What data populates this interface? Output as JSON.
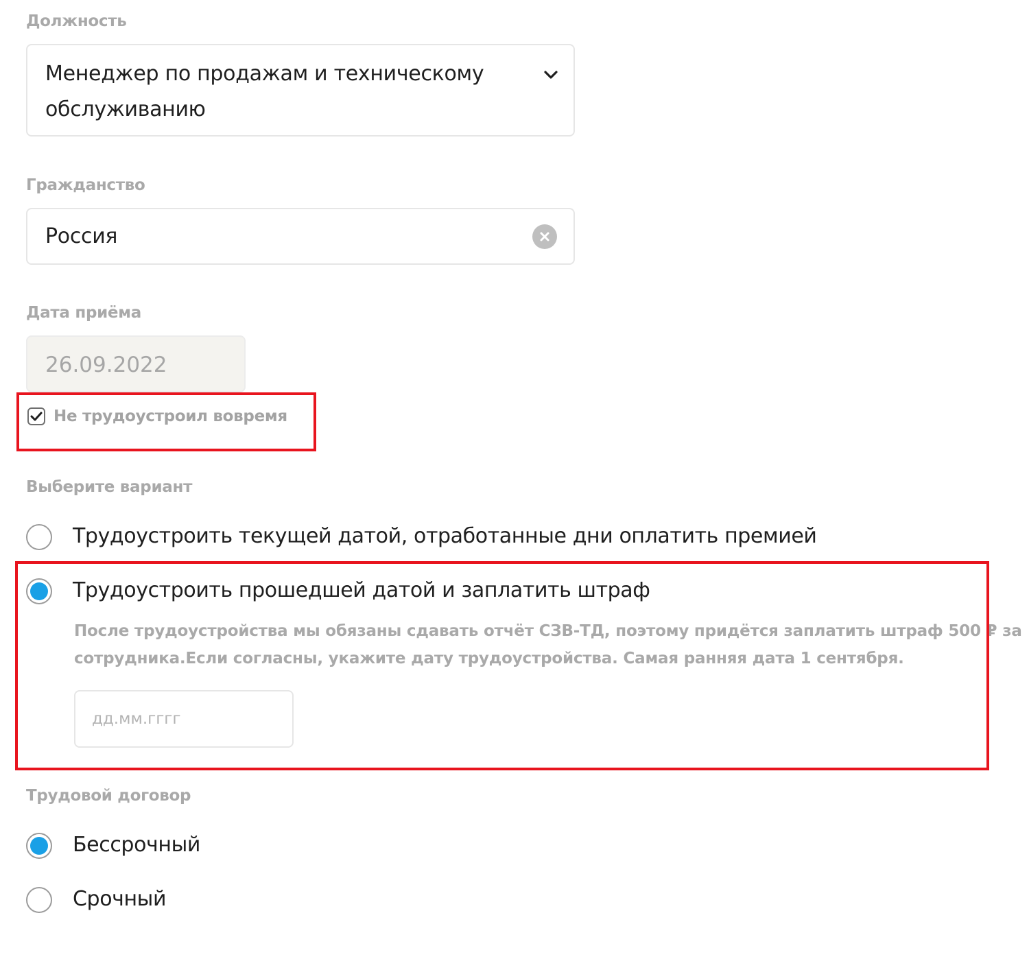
{
  "position": {
    "label": "Должность",
    "value_line1": "Менеджер по продажам и техническому",
    "value_line2": "обслуживанию",
    "icon": "chevron-down-icon"
  },
  "citizenship": {
    "label": "Гражданство",
    "value": "Россия",
    "icon": "clear-icon"
  },
  "hire_date": {
    "label": "Дата приёма",
    "value": "26.09.2022",
    "checkbox_label": "Не трудоустроил вовремя",
    "checkbox_checked": true
  },
  "variant": {
    "label": "Выберите вариант",
    "options": [
      {
        "label": "Трудоустроить текущей датой, отработанные дни оплатить премией",
        "selected": false
      },
      {
        "label": "Трудоустроить прошедшей датой и заплатить штраф",
        "selected": true
      }
    ],
    "hint_line1": "После трудоустройства мы обязаны сдавать отчёт СЗВ-ТД, поэтому придётся заплатить штраф 500 ₽ за",
    "hint_line2": "сотрудника.Если согласны, укажите дату трудоустройства. Самая ранняя дата 1 сентября.",
    "date_placeholder": "дд.мм.гггг"
  },
  "contract": {
    "label": "Трудовой договор",
    "options": [
      {
        "label": "Бессрочный",
        "selected": true
      },
      {
        "label": "Срочный",
        "selected": false
      }
    ]
  },
  "colors": {
    "accent": "#1aa0e6",
    "highlight": "#e8141e",
    "label_gray": "#a9a9a9"
  }
}
